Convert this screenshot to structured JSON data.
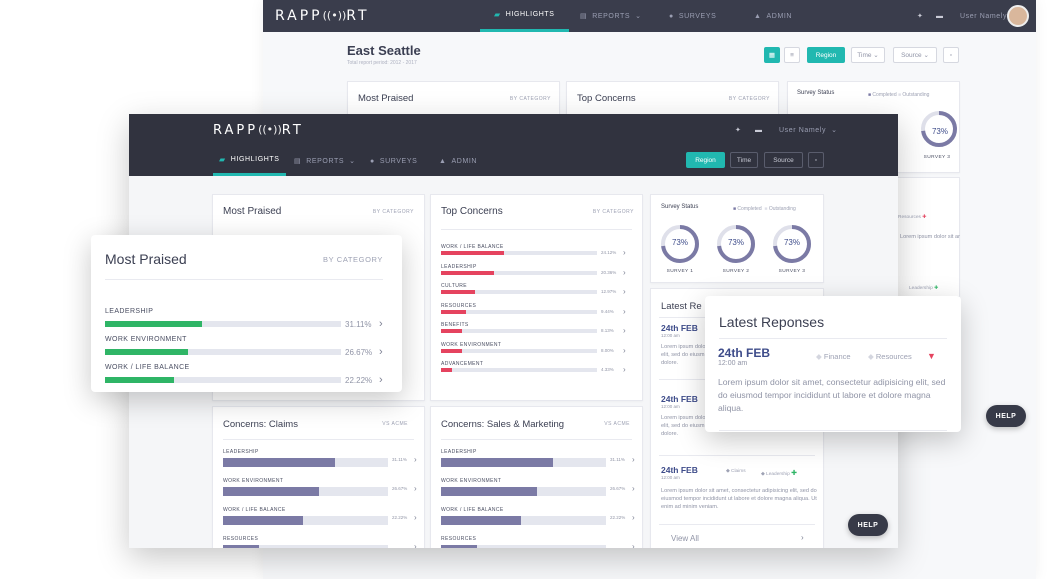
{
  "app": {
    "logo_text": "RAPP",
    "logo_mid": "((•))",
    "logo_end": "RT"
  },
  "nav": {
    "highlights": "HIGHLIGHTS",
    "reports": "REPORTS",
    "surveys": "SURVEYS",
    "admin": "ADMIN",
    "user": "User Namely"
  },
  "page": {
    "title": "East Seattle",
    "subtitle": "Total report period: 2012 - 2017"
  },
  "filters": {
    "region": "Region",
    "time": "Time",
    "source": "Source"
  },
  "colors": {
    "green": "#2fb566",
    "red": "#e5435f",
    "purple": "#7b7aa5",
    "teal": "#21b8b0",
    "navy": "#3e4c8a"
  },
  "most_praised": {
    "title": "Most Praised",
    "sub": "BY CATEGORY",
    "items": [
      {
        "label": "LEADERSHIP",
        "pct": "31.11%",
        "value": 31.11
      },
      {
        "label": "WORK ENVIRONMENT",
        "pct": "26.67%",
        "value": 26.67
      },
      {
        "label": "WORK / LIFE BALANCE",
        "pct": "22.22%",
        "value": 22.22
      }
    ]
  },
  "top_concerns": {
    "title": "Top Concerns",
    "sub": "BY CATEGORY",
    "items": [
      {
        "label": "WORK / LIFE BALANCE",
        "pct": "24.12%",
        "value": 24.12
      },
      {
        "label": "LEADERSHIP",
        "pct": "20.36%",
        "value": 20.36
      },
      {
        "label": "CULTURE",
        "pct": "12.97%",
        "value": 12.97
      },
      {
        "label": "RESOURCES",
        "pct": "9.44%",
        "value": 9.44
      },
      {
        "label": "BENEFITS",
        "pct": "8.13%",
        "value": 8.13
      },
      {
        "label": "WORK ENVIRONMENT",
        "pct": "8.00%",
        "value": 8.0
      },
      {
        "label": "ADVANCEMENT",
        "pct": "4.33%",
        "value": 4.33
      }
    ]
  },
  "survey_status": {
    "title": "Survey Status",
    "legend_completed": "Completed",
    "legend_outstanding": "Outstanding",
    "surveys": [
      {
        "label": "SURVEY 1",
        "pct": "73%",
        "value": 73
      },
      {
        "label": "SURVEY 2",
        "pct": "73%",
        "value": 73
      },
      {
        "label": "SURVEY 3",
        "pct": "73%",
        "value": 73
      }
    ]
  },
  "latest": {
    "title": "Latest Reponses",
    "title_short": "Latest Re",
    "view_all": "View All",
    "entries": [
      {
        "date": "24th FEB",
        "time": "12:00 am",
        "tag1": "Finance",
        "tag2": "Resources",
        "body": "Lorem ipsum dolor sit amet, consectetur adipisicing elit, sed do eiusmod tempor incididunt ut labore et dolore magna aliqua.",
        "trend": "down"
      },
      {
        "date": "24th FEB",
        "time": "12:00 am",
        "tag1": "",
        "tag2": "",
        "body": "Lorem ipsum dolor sit elit, sed do eiusm dolore.",
        "trend": ""
      },
      {
        "date": "24th FEB",
        "time": "12:00 am",
        "tag1": "Claims",
        "tag2": "Leadership",
        "body": "Lorem ipsum dolor sit amet, consectetur adipisicing elit, sed do eiusmod tempor incididunt ut labore et dolore magna aliqua. Ut enim ad minim veniam.",
        "trend": "up"
      }
    ]
  },
  "concerns_claims": {
    "title": "Concerns: Claims",
    "sub": "VS ACME",
    "items": [
      {
        "label": "LEADERSHIP",
        "pct": "31.11%",
        "value": 31.11
      },
      {
        "label": "WORK ENVIRONMENT",
        "pct": "26.67%",
        "value": 26.67
      },
      {
        "label": "WORK / LIFE BALANCE",
        "pct": "22.22%",
        "value": 22.22
      },
      {
        "label": "RESOURCES",
        "pct": "",
        "value": 10
      }
    ]
  },
  "concerns_sales": {
    "title": "Concerns: Sales & Marketing",
    "sub": "VS ACME",
    "items": [
      {
        "label": "LEADERSHIP",
        "pct": "31.11%",
        "value": 31.11
      },
      {
        "label": "WORK ENVIRONMENT",
        "pct": "26.67%",
        "value": 26.67
      },
      {
        "label": "WORK / LIFE BALANCE",
        "pct": "22.22%",
        "value": 22.22
      },
      {
        "label": "RESOURCES",
        "pct": "",
        "value": 10
      }
    ]
  },
  "help": "HELP"
}
